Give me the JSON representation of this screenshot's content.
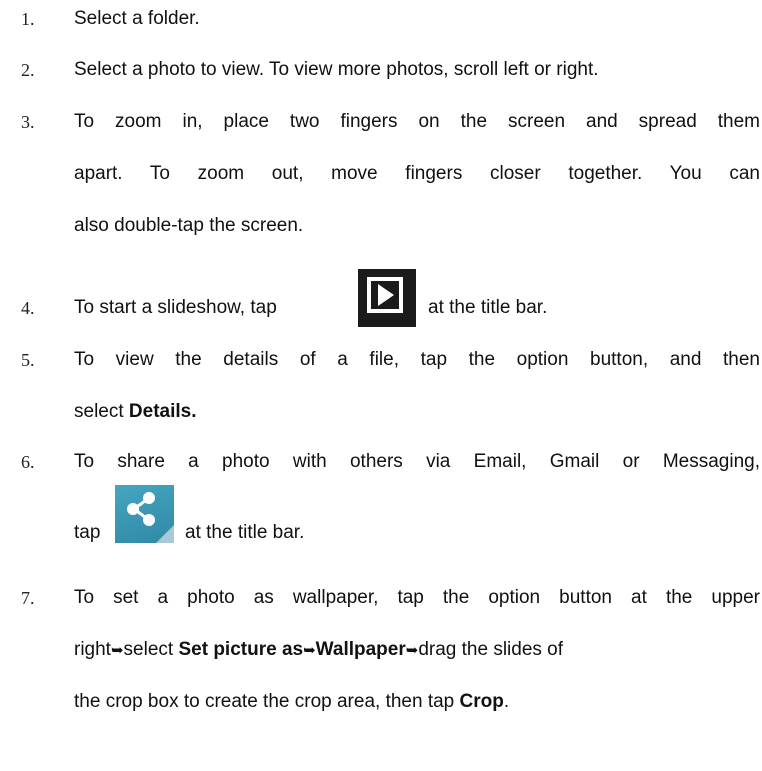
{
  "steps": [
    {
      "num": "1.",
      "text": "Select a folder."
    },
    {
      "num": "2.",
      "text": "Select a photo to view. To view more photos, scroll left or right."
    },
    {
      "num": "3.",
      "lines": [
        "To zoom in, place two fingers on the screen and spread them",
        "apart. To zoom out, move fingers closer together. You can",
        "also double-tap the screen."
      ]
    },
    {
      "num": "4.",
      "before": "To start a slideshow, tap",
      "after": "at the title bar.",
      "icon": "play-slideshow-icon"
    },
    {
      "num": "5.",
      "line1": "To view the details of a file, tap the option button, and then",
      "line2_prefix": "select",
      "line2_bold": "Details."
    },
    {
      "num": "6.",
      "line1": "To share a photo with others via Email, Gmail or Messaging,",
      "before": "tap",
      "after": "at the title bar.",
      "icon": "share-icon"
    },
    {
      "num": "7.",
      "line1": "To set a photo as wallpaper, tap the option button at the upper",
      "l2_a": "right",
      "arrow": "➥",
      "l2_b": "select",
      "l2_bold1": "Set picture as",
      "l2_bold2": "Wallpaper",
      "l2_c": "drag the slides of",
      "line3_prefix": "the crop box to create the crop area, then tap",
      "line3_bold": "Crop",
      "line3_suffix": "."
    }
  ],
  "colors": {
    "text": "#111111",
    "share_icon_bg": "#3a97b4",
    "play_icon_bg": "#1b1b1b"
  }
}
